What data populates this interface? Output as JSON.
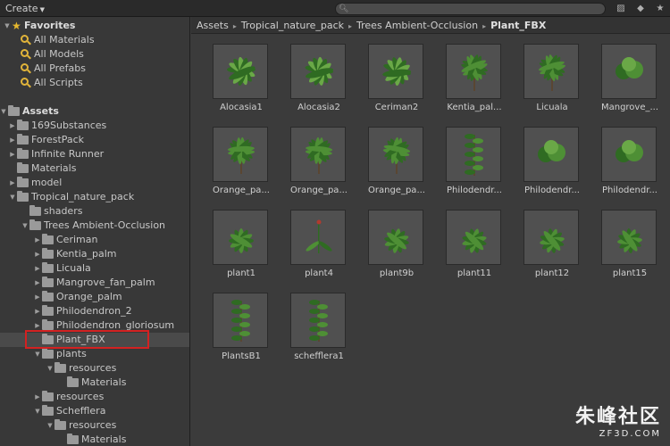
{
  "toolbar": {
    "create_label": "Create",
    "create_arrow": "▼",
    "icons": [
      "search-icon",
      "label-icon",
      "tag-icon",
      "star-icon"
    ]
  },
  "favorites": {
    "title": "Favorites",
    "items": [
      "All Materials",
      "All Models",
      "All Prefabs",
      "All Scripts"
    ]
  },
  "tree": {
    "root": "Assets",
    "items": [
      {
        "label": "169Substances"
      },
      {
        "label": "ForestPack"
      },
      {
        "label": "Infinite Runner"
      },
      {
        "label": "Materials"
      },
      {
        "label": "model"
      },
      {
        "label": "Tropical_nature_pack"
      },
      {
        "label": "shaders"
      },
      {
        "label": "Trees Ambient-Occlusion"
      },
      {
        "label": "Ceriman"
      },
      {
        "label": "Kentia_palm"
      },
      {
        "label": "Licuala"
      },
      {
        "label": "Mangrove_fan_palm"
      },
      {
        "label": "Orange_palm"
      },
      {
        "label": "Philodendron_2"
      },
      {
        "label": "Philodendron_gloriosum"
      },
      {
        "label": "Plant_FBX"
      },
      {
        "label": "plants"
      },
      {
        "label": "resources"
      },
      {
        "label": "Materials"
      },
      {
        "label": "resources"
      },
      {
        "label": "Schefflera"
      },
      {
        "label": "resources"
      },
      {
        "label": "Materials"
      }
    ]
  },
  "breadcrumb": {
    "items": [
      "Assets",
      "Tropical_nature_pack",
      "Trees Ambient-Occlusion"
    ],
    "current": "Plant_FBX",
    "separator": "▸"
  },
  "assets": [
    "Alocasia1",
    "Alocasia2",
    "Ceriman2",
    "Kentia_pal...",
    "Licuala",
    "Mangrove_...",
    "Orange_pa...",
    "Orange_pa...",
    "Orange_pa...",
    "Philodendr...",
    "Philodendr...",
    "Philodendr...",
    "plant1",
    "plant4",
    "plant9b",
    "plant11",
    "plant12",
    "plant15",
    "PlantsB1",
    "schefflera1"
  ],
  "watermark": {
    "logo_text": "朱峰社区",
    "url_text": "ZF3D.COM"
  },
  "colors": {
    "accent_star": "#e6b82e",
    "selection_outline": "#d32121",
    "plant_green": "#3f7a2e"
  }
}
